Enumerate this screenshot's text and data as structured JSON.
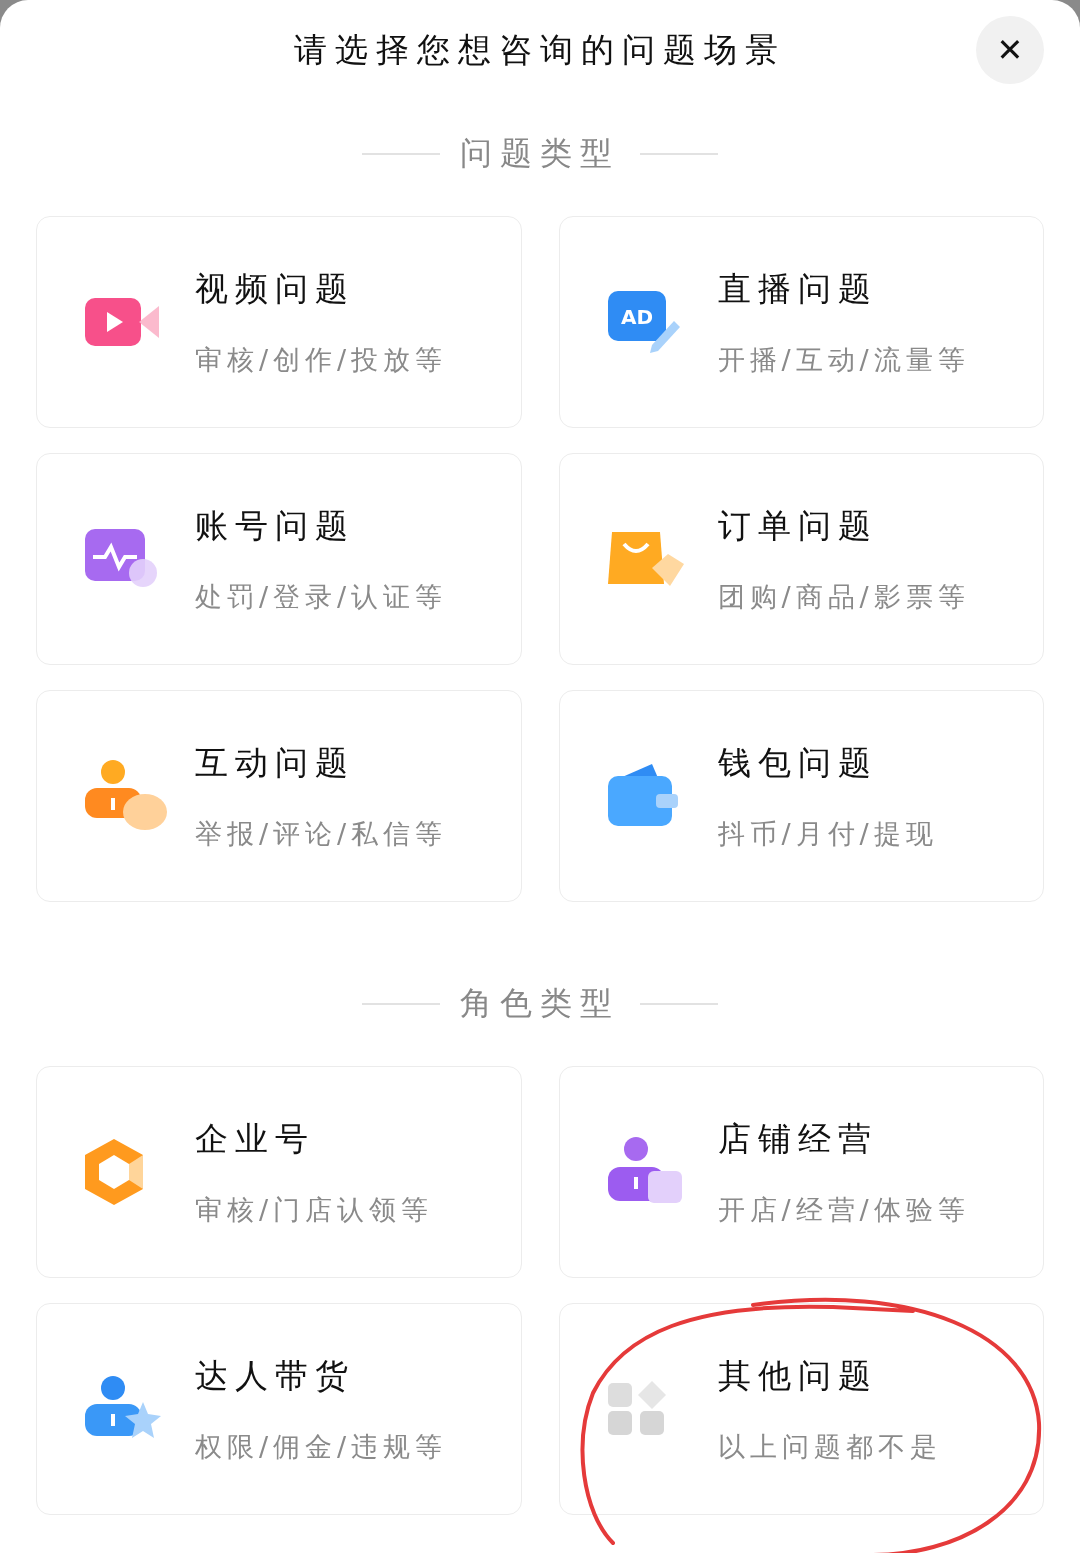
{
  "title": "请选择您想咨询的问题场景",
  "close": "✕",
  "sections": [
    {
      "heading": "问题类型",
      "cards": [
        {
          "kind": "video",
          "title": "视频问题",
          "subtitle": "审核/创作/投放等",
          "circled": false
        },
        {
          "kind": "live",
          "icon_text": "AD",
          "title": "直播问题",
          "subtitle": "开播/互动/流量等",
          "circled": false
        },
        {
          "kind": "account",
          "title": "账号问题",
          "subtitle": "处罚/登录/认证等",
          "circled": false
        },
        {
          "kind": "order",
          "title": "订单问题",
          "subtitle": "团购/商品/影票等",
          "circled": false
        },
        {
          "kind": "interact",
          "title": "互动问题",
          "subtitle": "举报/评论/私信等",
          "circled": false
        },
        {
          "kind": "wallet",
          "title": "钱包问题",
          "subtitle": "抖币/月付/提现",
          "circled": false
        }
      ]
    },
    {
      "heading": "角色类型",
      "cards": [
        {
          "kind": "enterprise",
          "title": "企业号",
          "subtitle": "审核/门店认领等",
          "circled": false
        },
        {
          "kind": "shop",
          "title": "店铺经营",
          "subtitle": "开店/经营/体验等",
          "circled": false
        },
        {
          "kind": "creator",
          "title": "达人带货",
          "subtitle": "权限/佣金/违规等",
          "circled": false
        },
        {
          "kind": "other",
          "title": "其他问题",
          "subtitle": "以上问题都不是",
          "circled": true
        }
      ]
    }
  ]
}
